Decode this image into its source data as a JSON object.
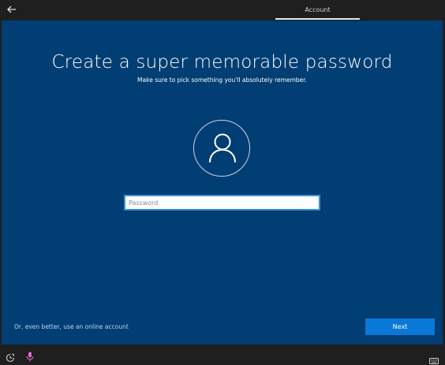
{
  "topbar": {
    "tab_label": "Account"
  },
  "main": {
    "title": "Create a super memorable password",
    "subtitle": "Make sure to pick something you'll absolutely remember.",
    "password_placeholder": "Password",
    "password_value": "",
    "online_account_link": "Or, even better, use an online account",
    "next_label": "Next"
  },
  "colors": {
    "panel_background": "#003e73",
    "accent": "#0a78d6",
    "chrome_background": "#1f1f1f",
    "link": "#b9d9ff"
  },
  "icons": {
    "back": "back-arrow-icon",
    "avatar": "user-icon",
    "ease_of_access": "ease-of-access-icon",
    "microphone": "microphone-icon",
    "keyboard": "keyboard-icon"
  }
}
